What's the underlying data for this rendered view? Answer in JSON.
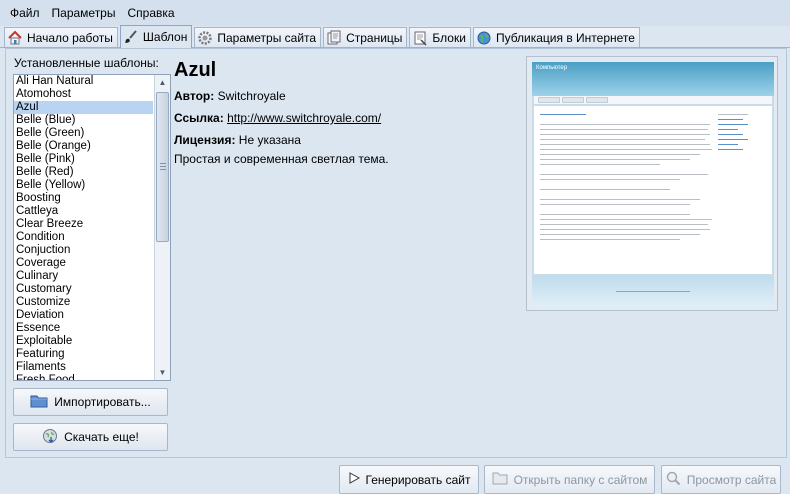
{
  "menu": [
    "Файл",
    "Параметры",
    "Справка"
  ],
  "tabs": [
    {
      "label": "Начало работы",
      "icon": "home-icon"
    },
    {
      "label": "Шаблон",
      "icon": "brush-icon",
      "active": true
    },
    {
      "label": "Параметры сайта",
      "icon": "gear-icon"
    },
    {
      "label": "Страницы",
      "icon": "page-icon"
    },
    {
      "label": "Блоки",
      "icon": "blocks-icon"
    },
    {
      "label": "Публикация в Интернете",
      "icon": "globe-icon"
    }
  ],
  "templates": {
    "caption": "Установленные шаблоны:",
    "items": [
      "Ali Han Natural",
      "Atomohost",
      "Azul",
      "Belle (Blue)",
      "Belle (Green)",
      "Belle (Orange)",
      "Belle (Pink)",
      "Belle (Red)",
      "Belle (Yellow)",
      "Boosting",
      "Cattleya",
      "Clear Breeze",
      "Condition",
      "Conjuction",
      "Coverage",
      "Culinary",
      "Customary",
      "Customize",
      "Deviation",
      "Essence",
      "Exploitable",
      "Featuring",
      "Filaments",
      "Fresh Food"
    ],
    "selected": "Azul"
  },
  "buttons": {
    "import": "Импортировать...",
    "download": "Скачать еще!",
    "generate": "Генерировать сайт",
    "open_folder": "Открыть папку с сайтом",
    "view_site": "Просмотр сайта"
  },
  "details": {
    "name": "Azul",
    "author_label": "Автор:",
    "author": "Switchroyale",
    "link_label": "Ссылка:",
    "link": "http://www.switchroyale.com/",
    "license_label": "Лицензия:",
    "license": "Не указана",
    "description": "Простая и современная светлая тема."
  },
  "preview": {
    "site_title": "Компьютер"
  },
  "colors": {
    "background": "#dbe6f1",
    "selection": "#b9d4f3",
    "preview_header": "#4a9fc5"
  }
}
